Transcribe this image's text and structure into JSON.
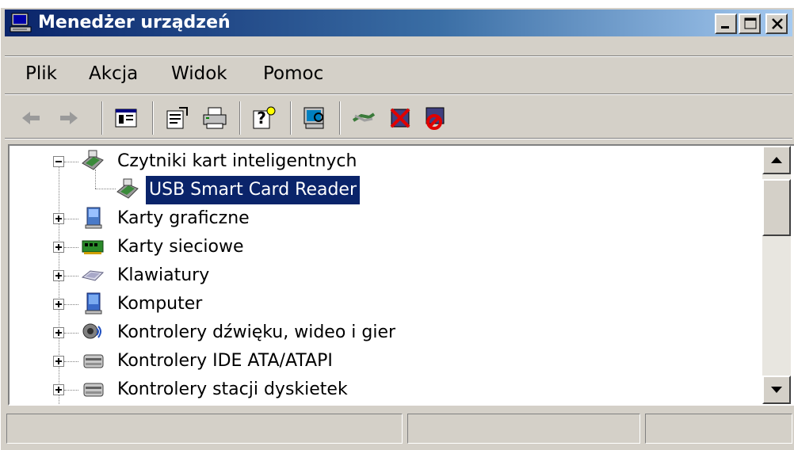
{
  "window": {
    "title": "Menedżer urządzeń",
    "title_icon": "computer-icon",
    "controls": [
      "minimize-icon",
      "maximize-icon",
      "close-icon"
    ]
  },
  "menu": {
    "items": [
      "Plik",
      "Akcja",
      "Widok",
      "Pomoc"
    ]
  },
  "toolbar": {
    "buttons": [
      "back-arrow-icon",
      "forward-arrow-icon",
      "show-hide-tree-icon",
      "properties-icon",
      "print-icon",
      "help-icon",
      "scan-hardware-icon",
      "update-driver-icon",
      "uninstall-icon",
      "disable-icon"
    ]
  },
  "tree": {
    "expanded_category": {
      "label": "Czytniki kart inteligentnych",
      "icon": "smart-card-reader-icon",
      "children": [
        {
          "label": "USB Smart Card Reader",
          "icon": "smart-card-reader-icon",
          "selected": true
        }
      ]
    },
    "categories": [
      {
        "label": "Karty graficzne",
        "icon": "display-adapter-icon"
      },
      {
        "label": "Karty sieciowe",
        "icon": "network-adapter-icon"
      },
      {
        "label": "Klawiatury",
        "icon": "keyboard-icon"
      },
      {
        "label": "Komputer",
        "icon": "computer-icon"
      },
      {
        "label": "Kontrolery dźwięku, wideo i gier",
        "icon": "sound-controller-icon"
      },
      {
        "label": "Kontrolery IDE ATA/ATAPI",
        "icon": "ide-controller-icon"
      },
      {
        "label": "Kontrolery stacji dyskietek",
        "icon": "floppy-controller-icon"
      }
    ]
  },
  "statusbar": {
    "panels": [
      "",
      "",
      ""
    ]
  },
  "colors": {
    "titlebar_start": "#0a246a",
    "titlebar_end": "#a6caf0",
    "selection": "#0a246a",
    "chrome": "#d4d0c8"
  }
}
